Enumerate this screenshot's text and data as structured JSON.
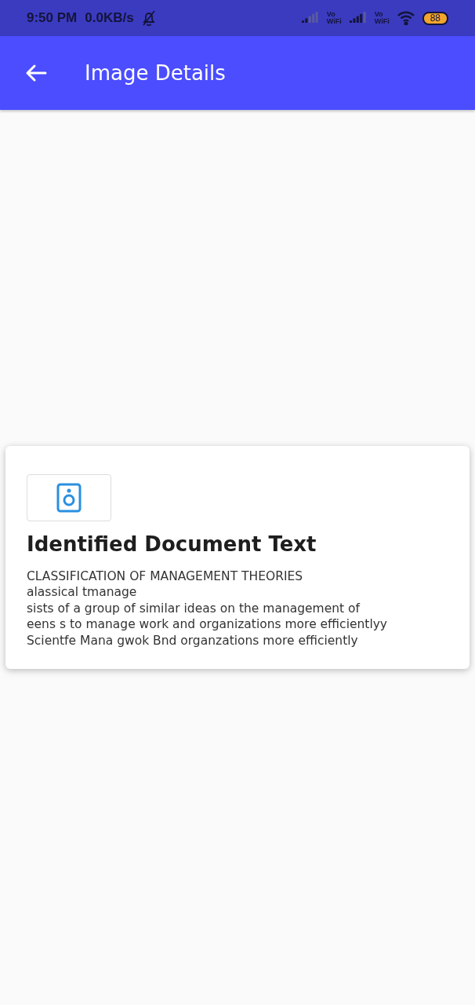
{
  "status_bar": {
    "time": "9:50 PM",
    "speed": "0.0KB/s",
    "battery": "88",
    "network_labels": [
      {
        "top": "Vo",
        "bottom": "WiFi"
      },
      {
        "top": "Vo",
        "bottom": "WiFi"
      }
    ]
  },
  "app_bar": {
    "title": "Image Details"
  },
  "card": {
    "title": "Identified Document Text",
    "lines": [
      "CLASSIFICATION OF MANAGEMENT THEORIES",
      "alassical tmanage",
      "sists of a group of similar ideas on the management of",
      "eens s to manage work and organizations more efficientlyy",
      "Scientfe Mana gwok Bnd organzations more efficiently"
    ]
  }
}
